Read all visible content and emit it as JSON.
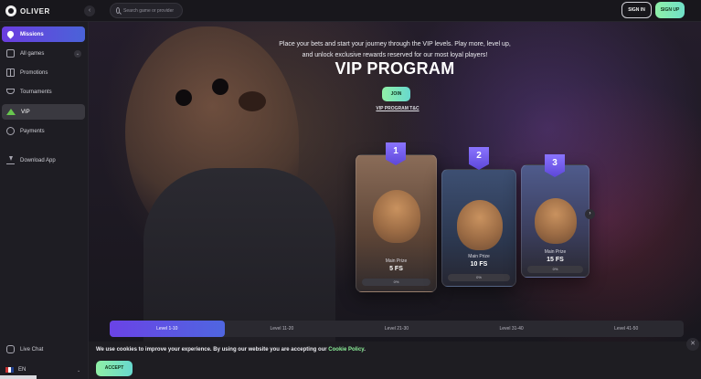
{
  "brand": {
    "name": "OLIVER"
  },
  "header": {
    "search_placeholder": "Search game or provider",
    "sign_in_label": "SIGN IN",
    "sign_up_label": "SIGN UP"
  },
  "sidebar": {
    "collapse_icon": "chevron-left-icon",
    "items": [
      {
        "label": "Missions",
        "icon": "rocket-icon"
      },
      {
        "label": "All games",
        "icon": "cards-icon"
      },
      {
        "label": "Promotions",
        "icon": "gift-icon"
      },
      {
        "label": "Tournaments",
        "icon": "trophy-icon"
      },
      {
        "label": "VIP",
        "icon": "crown-icon"
      },
      {
        "label": "Payments",
        "icon": "coins-icon"
      },
      {
        "label": "Download App",
        "icon": "download-icon"
      }
    ],
    "live_chat_label": "Live Chat",
    "language_label": "EN"
  },
  "hero": {
    "intro_line1": "Place your bets and start your journey through the VIP levels. Play more, level up,",
    "intro_line2": "and unlock exclusive rewards reserved for our most loyal players!",
    "title": "VIP PROGRAM",
    "join_label": "JOIN",
    "tc_label": "VIP PROGRAM T&C"
  },
  "cards": [
    {
      "level": "1",
      "prize_label": "Main Prize",
      "prize_value": "5 FS",
      "progress": "0%"
    },
    {
      "level": "2",
      "prize_label": "Main Prize",
      "prize_value": "10 FS",
      "progress": "0%"
    },
    {
      "level": "3",
      "prize_label": "Main Prize",
      "prize_value": "15 FS",
      "progress": "0%"
    }
  ],
  "levels": [
    {
      "label": "Level 1-10",
      "active": true
    },
    {
      "label": "Level 11-20",
      "active": false
    },
    {
      "label": "Level 21-30",
      "active": false
    },
    {
      "label": "Level 31-40",
      "active": false
    },
    {
      "label": "Level 41-50",
      "active": false
    }
  ],
  "cookie": {
    "text": "We use cookies to improve your experience. By using our website you are accepting our ",
    "policy_label": "Cookie Policy",
    "period": ".",
    "accept_label": "ACCEPT"
  }
}
